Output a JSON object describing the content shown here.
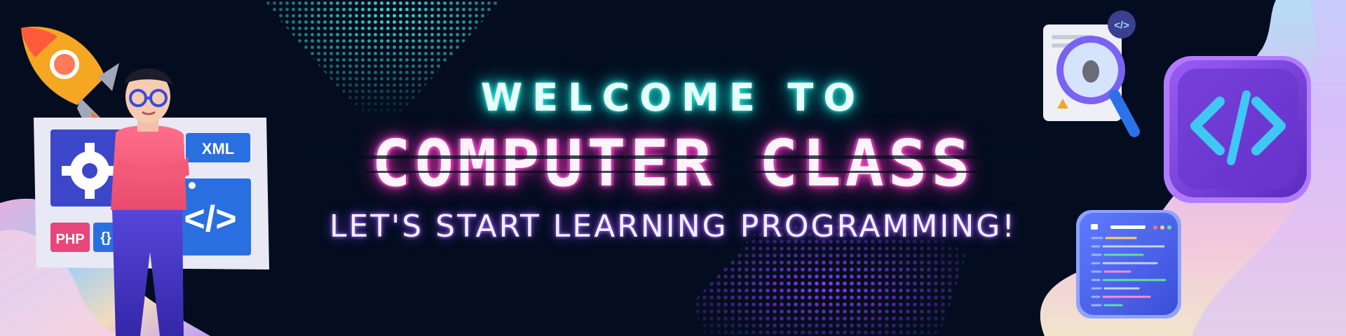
{
  "banner": {
    "welcome": "WELCOME TO",
    "title": "COMPUTER CLASS",
    "tagline": "LET'S START LEARNING PROGRAMMING!"
  },
  "left_panel": {
    "xml_label": "XML",
    "php_label": "PHP",
    "braces_label": "{}",
    "code_label": "</>"
  },
  "right_icons": {
    "badge_label": "</>"
  },
  "colors": {
    "background": "#030d1f",
    "welcome_glow": "#19d7cd",
    "title_glow": "#e63ab8",
    "tagline_glow": "#7c3cf0",
    "code_icon": "#7a3de0",
    "panel_blue": "#1f5fd0"
  }
}
